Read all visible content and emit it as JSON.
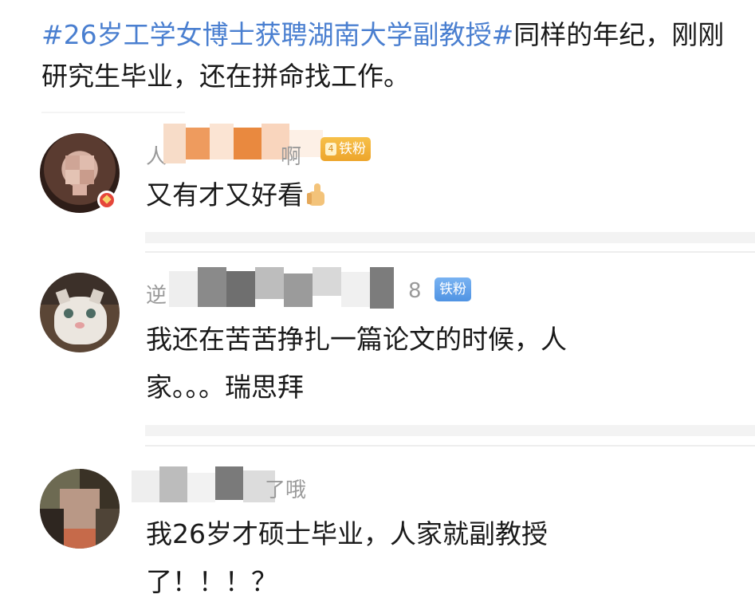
{
  "post": {
    "hashtag": "#26岁工学女博士获聘湖南大学副教授#",
    "text": "同样的年纪，刚刚研究生毕业，还在拼命找工作。"
  },
  "comments": [
    {
      "name_visible_start": "人",
      "name_visible_end": "啊",
      "badge": "铁粉",
      "badge_level": "4",
      "text": "又有才又好看",
      "emoji_icon": "thumbs-up-icon"
    },
    {
      "name_visible_start": "逆",
      "name_visible_end": "8",
      "badge": "铁粉",
      "text_line1": "我还在苦苦挣扎一篇论文的时候，人",
      "text_line2": "家。。。瑞思拜"
    },
    {
      "name_visible_end": "了哦",
      "text_line1": "我26岁才硕士毕业，人家就副教授",
      "text_line2": "了！！！？"
    }
  ],
  "colors": {
    "hashtag": "#4a7fd0",
    "badge_fan_orange": "#eda52b",
    "badge_fan_blue": "#4f93e3"
  }
}
